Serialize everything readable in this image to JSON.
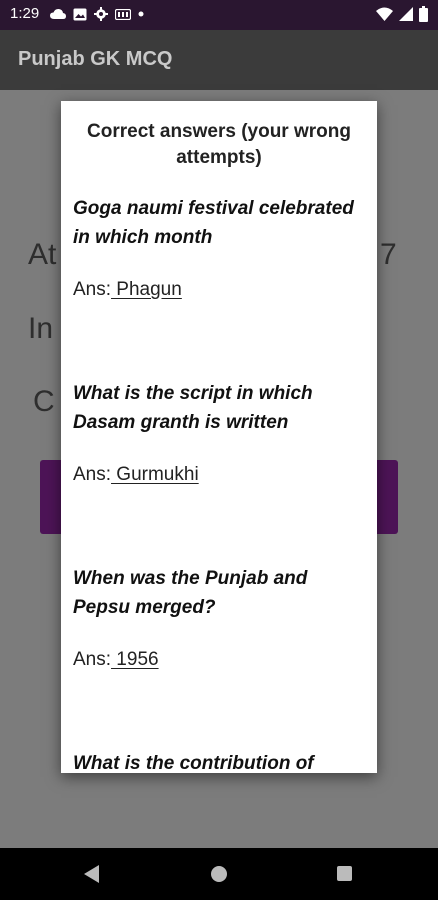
{
  "status_bar": {
    "time": "1:29",
    "icons": [
      "cloud-icon",
      "image-icon",
      "gear-icon",
      "sim-icon",
      "dot-icon"
    ],
    "right_icons": [
      "wifi-icon",
      "signal-icon",
      "battery-icon"
    ]
  },
  "app_bar": {
    "title": "Punjab GK MCQ"
  },
  "background": {
    "line1_left": "At",
    "line1_right": "7",
    "line2_left": "In",
    "line3_left": "C"
  },
  "dialog": {
    "title": "Correct answers  (your wrong attempts)",
    "items": [
      {
        "question": "Goga naumi festival celebrated in which month",
        "ans_label": "Ans:",
        "ans_value": " Phagun "
      },
      {
        "question": "What is the script in which Dasam granth is written",
        "ans_label": "Ans:",
        "ans_value": " Gurmukhi "
      },
      {
        "question": "When was the Punjab and Pepsu merged?",
        "ans_label": "Ans:",
        "ans_value": " 1956 "
      },
      {
        "question": "What is the contribution of"
      }
    ]
  },
  "nav_bar": {
    "buttons": [
      "back-icon",
      "home-icon",
      "recents-icon"
    ]
  }
}
